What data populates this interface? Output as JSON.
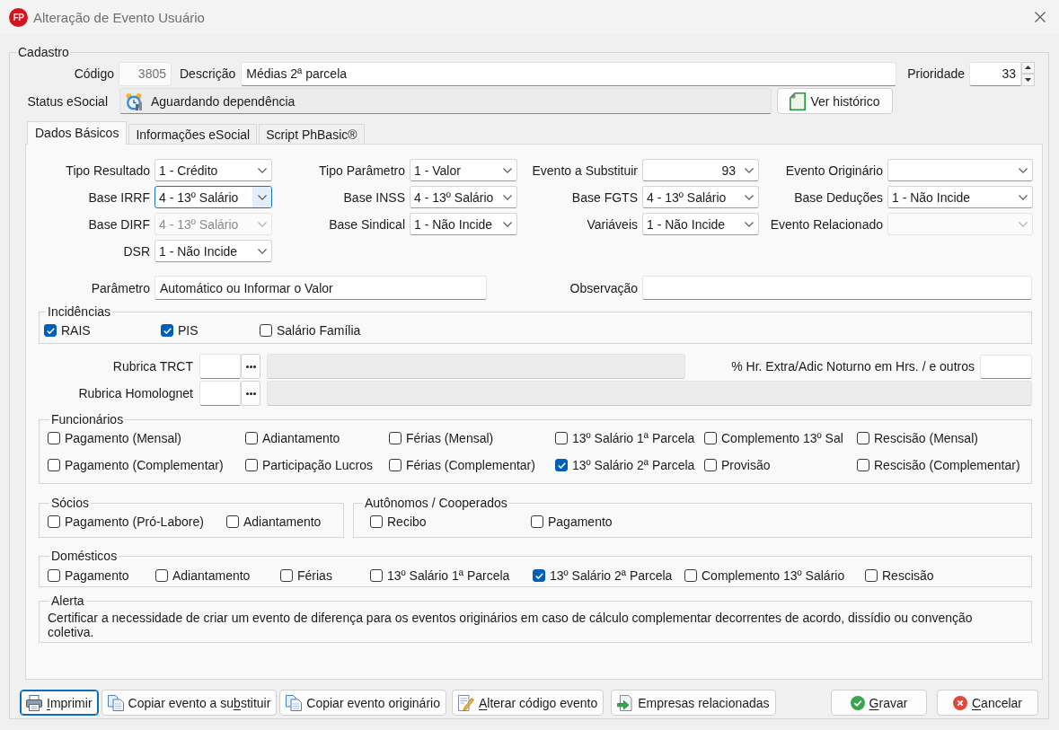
{
  "window": {
    "logo_text": "FP",
    "title": "Alteração de Evento Usuário"
  },
  "cadastro": {
    "title": "Cadastro",
    "codigo": {
      "label": "Código",
      "value": "3805",
      "disabled": true
    },
    "descricao": {
      "label": "Descrição",
      "value": "Médias 2ª parcela"
    },
    "prioridade": {
      "label": "Prioridade",
      "value": "33"
    },
    "status_esocial": {
      "label": "Status eSocial",
      "value": "Aguardando dependência"
    },
    "history_button": {
      "label": "Ver histórico"
    }
  },
  "tabs": [
    {
      "label": "Dados Básicos",
      "selected": true
    },
    {
      "label": "Informações eSocial",
      "selected": false
    },
    {
      "label": "Script PhBasic®",
      "selected": false
    }
  ],
  "basic_data": {
    "field_rows": [
      [
        {
          "label": "Tipo Resultado",
          "kind": "text",
          "value": "1 - Crédito",
          "focused": false,
          "disabled": false
        },
        {
          "label": "Tipo Parâmetro",
          "kind": "text",
          "value": "1 - Valor",
          "focused": false,
          "disabled": false
        },
        {
          "label": "Evento a Substituir",
          "kind": "number",
          "value": "93",
          "focused": false,
          "disabled": false
        },
        {
          "label": "Evento Originário",
          "kind": "text",
          "focused": false,
          "disabled": false
        }
      ],
      [
        {
          "label": "Base IRRF",
          "kind": "text",
          "value": "4 - 13º Salário",
          "focused": true,
          "disabled": false
        },
        {
          "label": "Base INSS",
          "kind": "text",
          "value": "4 - 13º Salário",
          "focused": false,
          "disabled": false
        },
        {
          "label": "Base FGTS",
          "kind": "text",
          "value": "4 - 13º Salário",
          "focused": false,
          "disabled": false
        },
        {
          "label": "Base Deduções",
          "kind": "text",
          "value": "1 - Não Incide",
          "focused": false,
          "disabled": false
        }
      ],
      [
        {
          "label": "Base DIRF",
          "kind": "text",
          "value": "4 - 13º Salário",
          "focused": false,
          "disabled": true
        },
        {
          "label": "Base Sindical",
          "kind": "text",
          "value": "1 - Não Incide",
          "focused": false,
          "disabled": false
        },
        {
          "label": "Variáveis",
          "kind": "text",
          "value": "1 - Não Incide",
          "focused": false,
          "disabled": false
        },
        {
          "label": "Evento Relacionado",
          "kind": "text",
          "focused": false,
          "disabled": true
        }
      ],
      [
        {
          "label": "DSR",
          "kind": "text",
          "value": "1 - Não Incide",
          "focused": false,
          "disabled": false
        }
      ]
    ],
    "parametro": {
      "label": "Parâmetro",
      "value": "Automático ou Informar o Valor"
    },
    "observacao": {
      "label": "Observação"
    },
    "incidencias": {
      "title": "Incidências",
      "items": [
        {
          "label": "RAIS",
          "checked": true
        },
        {
          "label": "PIS",
          "checked": true
        },
        {
          "label": "Salário Família",
          "checked": false
        }
      ]
    },
    "rubricas": [
      {
        "label": "Rubrica TRCT"
      },
      {
        "label": "Rubrica Homolognet"
      }
    ],
    "hr_extra": {
      "label": "% Hr. Extra/Adic Noturno em Hrs. / e outros"
    },
    "funcionarios": {
      "title": "Funcionários",
      "items": [
        {
          "label": "Pagamento (Mensal)",
          "checked": false
        },
        {
          "label": "Adiantamento",
          "checked": false
        },
        {
          "label": "Férias (Mensal)",
          "checked": false
        },
        {
          "label": "13º Salário 1ª Parcela",
          "checked": false
        },
        {
          "label": "Complemento 13º Sal",
          "checked": false
        },
        {
          "label": "Rescisão (Mensal)",
          "checked": false
        },
        {
          "label": "Pagamento (Complementar)",
          "checked": false
        },
        {
          "label": "Participação Lucros",
          "checked": false
        },
        {
          "label": "Férias (Complementar)",
          "checked": false
        },
        {
          "label": "13º Salário 2ª Parcela",
          "checked": true
        },
        {
          "label": "Provisão",
          "checked": false
        },
        {
          "label": "Rescisão (Complementar)",
          "checked": false
        }
      ]
    },
    "socios": {
      "title": "Sócios",
      "items": [
        {
          "label": "Pagamento (Pró-Labore)",
          "checked": false
        },
        {
          "label": "Adiantamento",
          "checked": false
        }
      ]
    },
    "autonomos": {
      "title": "Autônomos / Cooperados",
      "items": [
        {
          "label": "Recibo",
          "checked": false
        },
        {
          "label": "Pagamento",
          "checked": false
        }
      ]
    },
    "domesticos": {
      "title": "Domésticos",
      "items": [
        {
          "label": "Pagamento",
          "checked": false
        },
        {
          "label": "Adiantamento",
          "checked": false
        },
        {
          "label": "Férias",
          "checked": false
        },
        {
          "label": "13º Salário 1ª Parcela",
          "checked": false
        },
        {
          "label": "13º Salário 2ª Parcela",
          "checked": true
        },
        {
          "label": "Complemento 13º Salário",
          "checked": false
        },
        {
          "label": "Rescisão",
          "checked": false
        }
      ]
    },
    "alerta": {
      "title": "Alerta",
      "text": "Certificar a necessidade de criar um evento de diferença para os eventos originários em caso de cálculo complementar decorrentes de acordo, dissídio ou convenção coletiva."
    }
  },
  "buttons": [
    {
      "kind": "print",
      "focused": true,
      "parts": [
        {
          "text": "I",
          "underlined": true
        },
        {
          "text": "mprimir",
          "underlined": false
        }
      ]
    },
    {
      "kind": "copy",
      "focused": false,
      "parts": [
        {
          "text": "Copiar evento a su",
          "underlined": false
        },
        {
          "text": "b",
          "underlined": true
        },
        {
          "text": "stituir",
          "underlined": false
        }
      ]
    },
    {
      "kind": "copy",
      "focused": false,
      "parts": [
        {
          "text": "Copiar evento originário",
          "underlined": false
        }
      ]
    },
    {
      "kind": "edit",
      "focused": false,
      "parts": [
        {
          "text": "A",
          "underlined": true
        },
        {
          "text": "lterar código evento",
          "underlined": false
        }
      ]
    },
    {
      "kind": "related",
      "focused": false,
      "parts": [
        {
          "text": "Empresas relacionadas",
          "underlined": false
        }
      ]
    },
    {
      "kind": "save",
      "focused": false,
      "parts": [
        {
          "text": "G",
          "underlined": true
        },
        {
          "text": "ravar",
          "underlined": false
        }
      ]
    },
    {
      "kind": "cancel",
      "focused": false,
      "parts": [
        {
          "text": "C",
          "underlined": true
        },
        {
          "text": "ancelar",
          "underlined": false
        }
      ]
    }
  ]
}
